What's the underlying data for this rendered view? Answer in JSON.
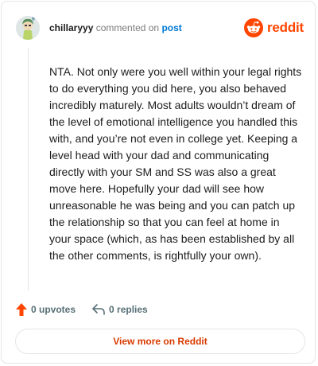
{
  "header": {
    "username": "chillaryyy",
    "action_text": "commented on",
    "post_link": "post",
    "logo_text": "reddit",
    "logo_icon": "reddit-alien-icon",
    "brand_color": "#ff4500"
  },
  "comment": {
    "body": "NTA. Not only were you well within your legal rights to do everything you did here, you also behaved incredibly maturely. Most adults wouldn’t dream of the level of emotional intelligence you handled this with, and you’re not even in college yet. Keeping a level head with your dad and communicating directly with your SM and SS was also a great move here. Hopefully your dad will see how unreasonable he was being and you can patch up the relationship so that you can feel at home in your space (which, as has been established by all the other comments, is rightfully your own)."
  },
  "actions": {
    "upvotes_label": "0 upvotes",
    "upvote_icon": "upvote-arrow-icon",
    "upvote_color": "#ff4500",
    "replies_label": "0 replies",
    "reply_icon": "reply-arrow-icon"
  },
  "footer": {
    "view_more_label": "View more on Reddit",
    "view_more_color": "#d93a00"
  }
}
